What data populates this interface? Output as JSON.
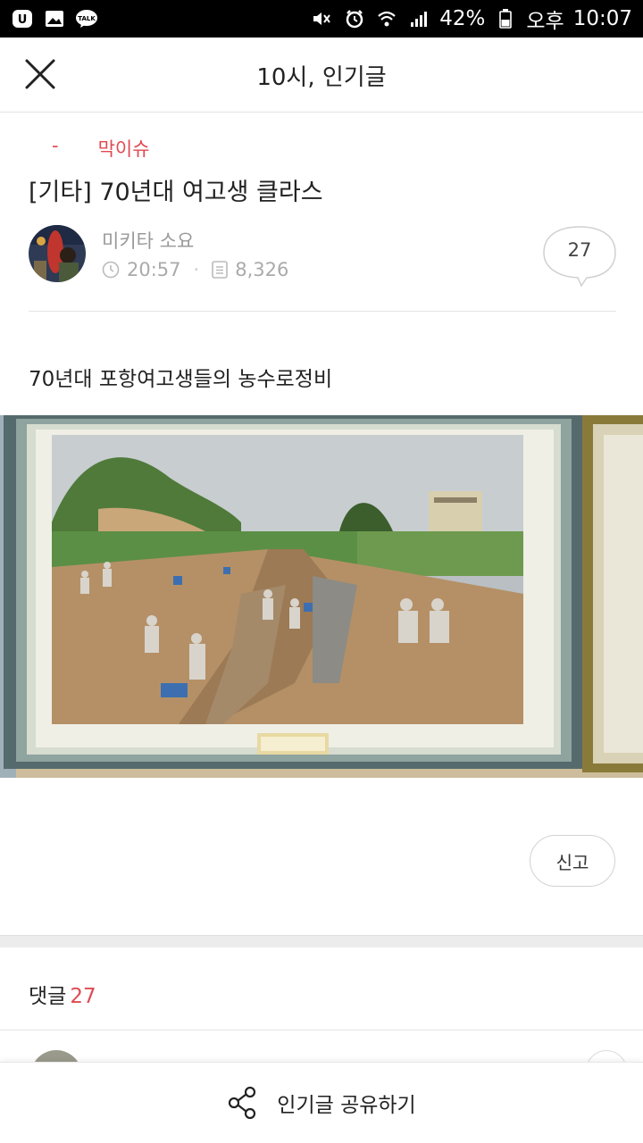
{
  "status_bar": {
    "left_icons": [
      "carrier-u-icon",
      "gallery-icon",
      "kakaotalk-icon"
    ],
    "talk_badge": "TALK",
    "battery": "42%",
    "ampm": "오후",
    "time": "10:07"
  },
  "header": {
    "title": "10시, 인기글",
    "close_icon": "close-icon"
  },
  "post": {
    "category_prefix": "-",
    "category": "막이슈",
    "title": "[기타] 70년대 여고생 클라스",
    "author": "미키타 소요",
    "time": "20:57",
    "views": "8,326",
    "comment_count": "27",
    "body_text": "70년대 포항여고생들의 농수로정비"
  },
  "report_label": "신고",
  "comments": {
    "label": "댓글",
    "count": "27"
  },
  "share": {
    "label": "인기글 공유하기",
    "icon": "share-icon"
  },
  "colors": {
    "accent": "#e04a52",
    "muted_text": "#999999",
    "divider": "#e3e3e3"
  }
}
